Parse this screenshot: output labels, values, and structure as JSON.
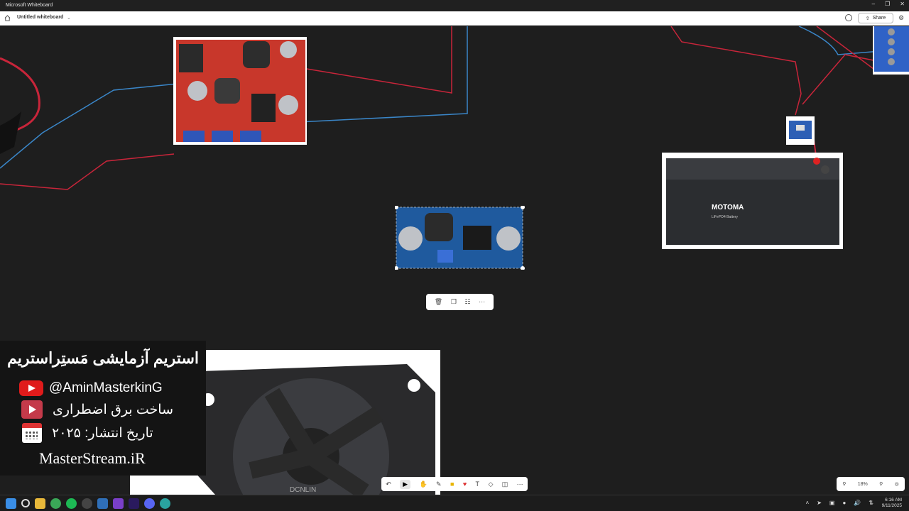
{
  "window": {
    "app_title": "Microsoft Whiteboard"
  },
  "toolbar": {
    "doc_title": "Untitled whiteboard",
    "share_label": "Share"
  },
  "canvas": {
    "battery": {
      "brand": "MOTOMA",
      "subtitle": "LiFePO4 Battery"
    },
    "fan_label": "DCNLIN"
  },
  "overlay": {
    "title": "استریم آزمایشی مَستِراستریم",
    "youtube": "@AminMasterkinG",
    "course": "ساخت برق اضطراری",
    "date": "تاریخ انتشار: ۲۰۲۵",
    "site": "MasterStream.iR"
  },
  "zoom": {
    "level": "18%"
  },
  "clock": {
    "time": "6:16 AM",
    "date": "9/11/2025"
  },
  "colors": {
    "wire_red": "#c8253a",
    "wire_blue": "#3a86c8",
    "canvas_bg": "#1e1e1e"
  }
}
